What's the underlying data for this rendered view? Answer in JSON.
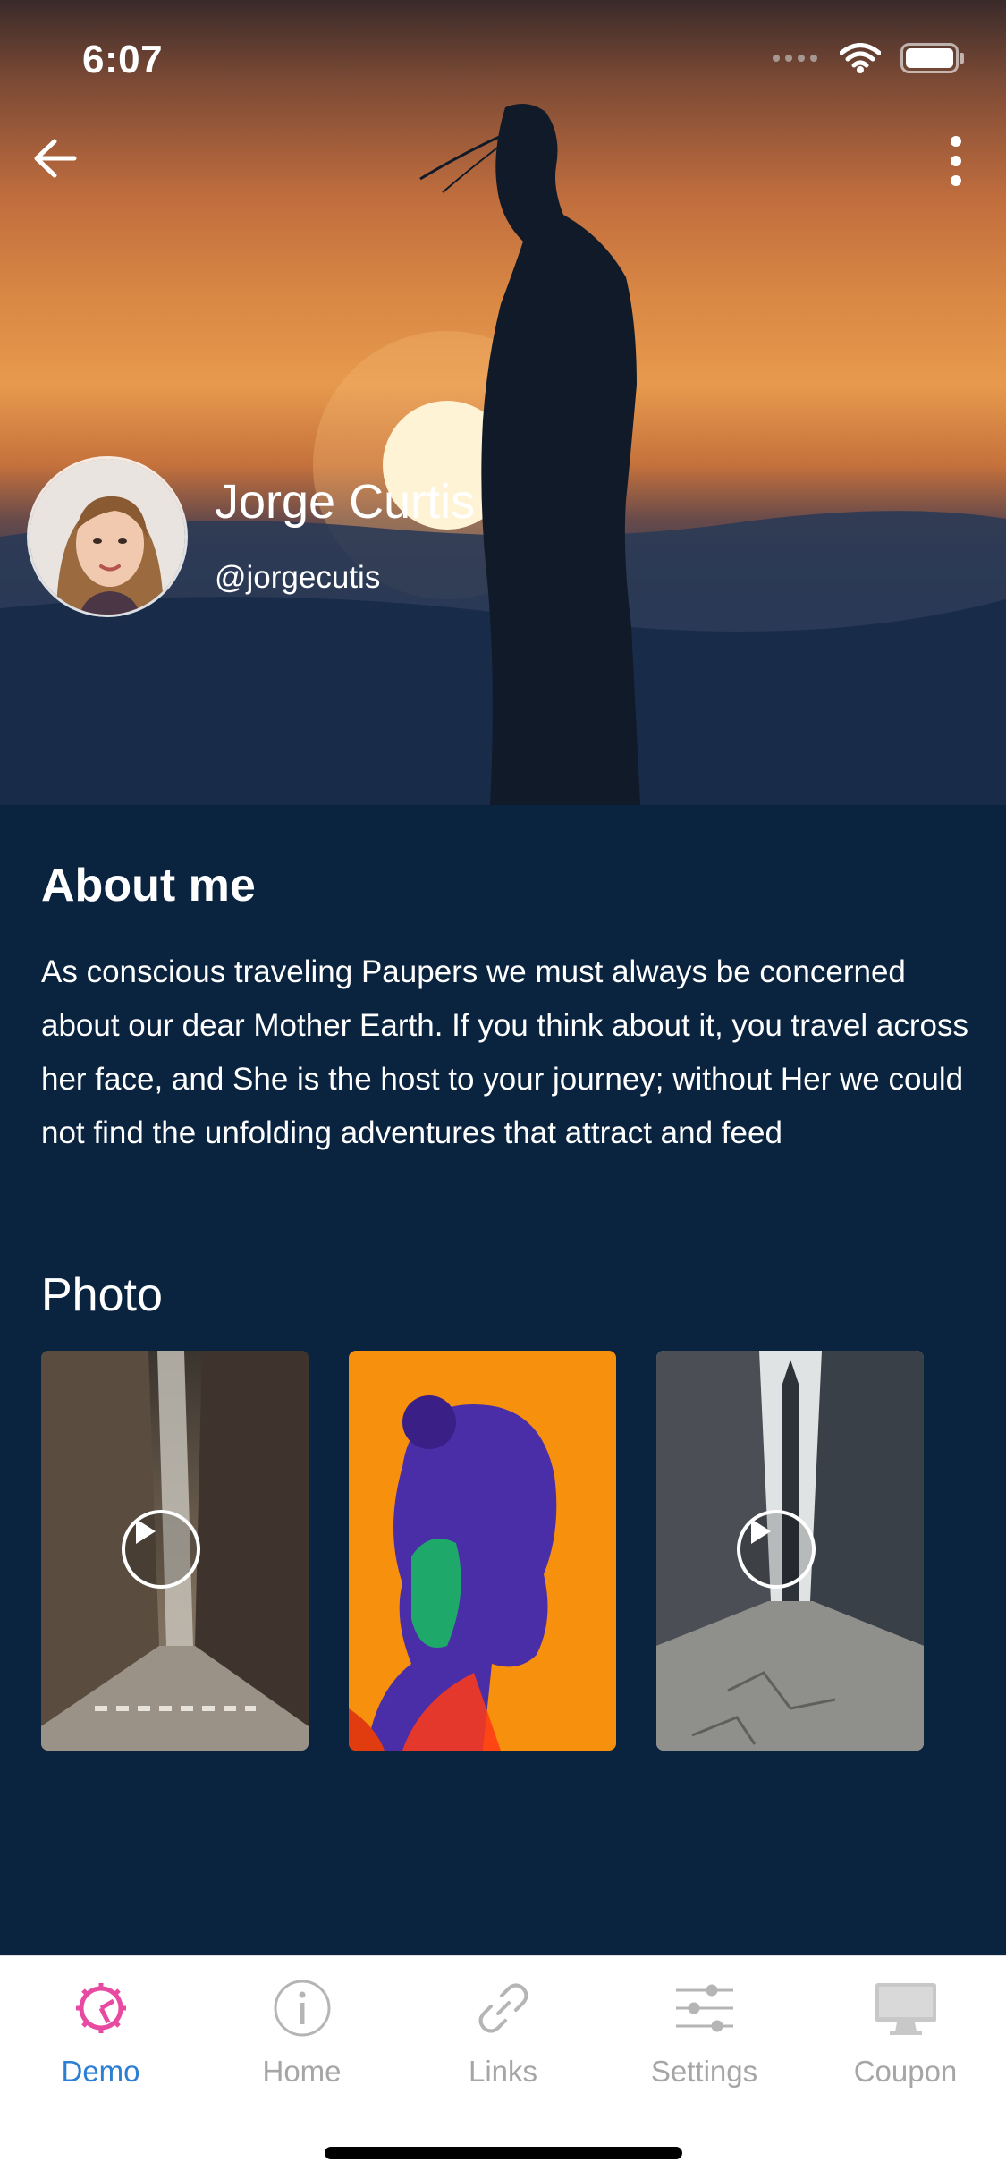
{
  "status_bar": {
    "time": "6:07",
    "signal_icon": "signal-dots-icon",
    "wifi_icon": "wifi-icon",
    "battery_icon": "battery-icon"
  },
  "header": {
    "back_icon": "arrow-left-icon",
    "more_icon": "more-vertical-icon"
  },
  "profile": {
    "name": "Jorge Curtis",
    "handle": "@jorgecutis"
  },
  "about": {
    "title": "About me",
    "text": "As conscious traveling Paupers we must always be concerned about our dear Mother Earth. If you think about it, you travel across her face, and She is the host to your journey; without Her we could not find the unfolding adventures that attract and feed"
  },
  "photos": {
    "title": "Photo",
    "items": [
      {
        "type": "video",
        "subject": "city street"
      },
      {
        "type": "image",
        "subject": "neon portrait"
      },
      {
        "type": "video",
        "subject": "city road"
      }
    ]
  },
  "tabbar": {
    "active": "Demo",
    "active_color": "#2d7fd3",
    "active_icon_color": "#e74aa0",
    "inactive_color": "#a6a6a6",
    "tabs": [
      {
        "label": "Demo",
        "icon": "gear-icon"
      },
      {
        "label": "Home",
        "icon": "info-icon"
      },
      {
        "label": "Links",
        "icon": "link-icon"
      },
      {
        "label": "Settings",
        "icon": "sliders-icon"
      },
      {
        "label": "Coupon",
        "icon": "monitor-icon"
      }
    ]
  }
}
